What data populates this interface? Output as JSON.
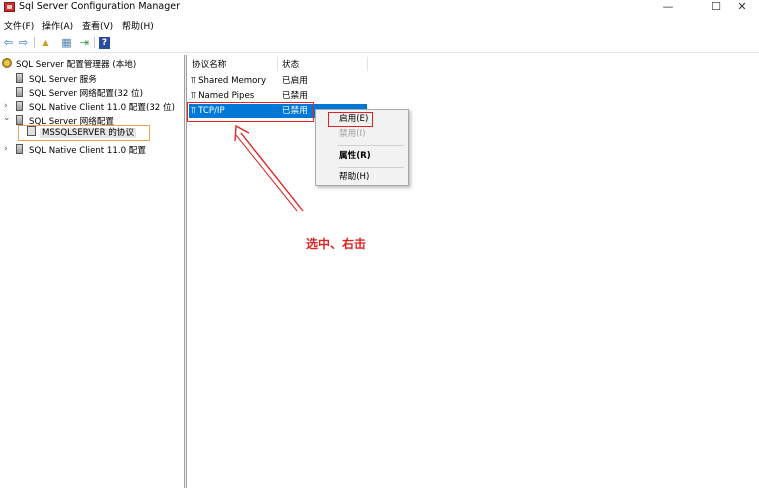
{
  "window": {
    "title": "Sql Server Configuration Manager",
    "controls": {
      "minimize": "—",
      "maximize": "☐",
      "close": "✕"
    }
  },
  "menu": [
    "文件(F)",
    "操作(A)",
    "查看(V)",
    "帮助(H)"
  ],
  "toolbar": {
    "back": "⇦",
    "forward": "⇨",
    "up": "▲",
    "show_hide": "▦",
    "export": "⇥",
    "help": "?"
  },
  "tree": [
    {
      "label": "SQL Server 配置管理器 (本地)",
      "icon": "config-manager-icon"
    },
    {
      "label": "SQL Server 服务",
      "icon": "server-icon"
    },
    {
      "label": "SQL Server 网络配置(32 位)",
      "icon": "server-icon"
    },
    {
      "label": "SQL Native Client 11.0 配置(32 位)",
      "icon": "server-icon",
      "expander": "›"
    },
    {
      "label": "SQL Server 网络配置",
      "icon": "server-icon",
      "expander": "⌄"
    },
    {
      "label": "MSSQLSERVER 的协议",
      "icon": "protocol-icon",
      "selected": true
    },
    {
      "label": "SQL Native Client 11.0 配置",
      "icon": "server-icon",
      "expander": "›"
    }
  ],
  "list": {
    "columns": [
      "协议名称",
      "状态"
    ],
    "rows": [
      {
        "name": "Shared Memory",
        "status": "已启用"
      },
      {
        "name": "Named Pipes",
        "status": "已禁用"
      },
      {
        "name": "TCP/IP",
        "status": "已禁用",
        "selected": true
      }
    ]
  },
  "context_menu": {
    "items": [
      {
        "label": "启用(E)",
        "enabled": true
      },
      {
        "label": "禁用(I)",
        "enabled": false
      },
      {
        "label": "属性(R)",
        "enabled": true,
        "bold": true
      },
      {
        "label": "帮助(H)",
        "enabled": true
      }
    ]
  },
  "annotation": {
    "text": "选中、右击",
    "color": "#e02424"
  },
  "colors": {
    "selection": "#0078d7",
    "annotation": "#e02424",
    "tree_highlight_border": "#f0a050"
  }
}
